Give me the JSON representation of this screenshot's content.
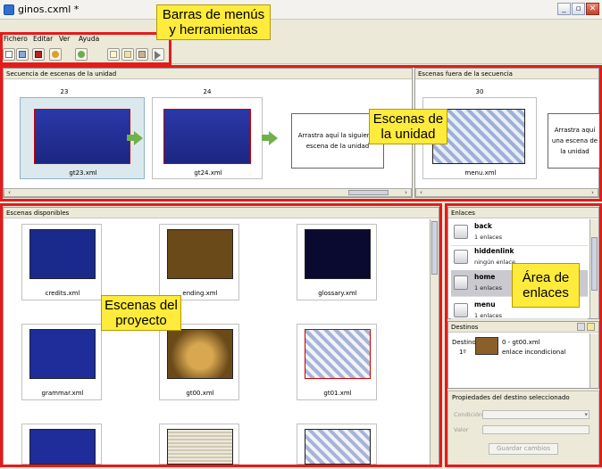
{
  "window": {
    "title": "ginos.cxml *"
  },
  "menubar": {
    "items": [
      "Fichero",
      "Editar",
      "Ver",
      "Ayuda"
    ]
  },
  "sequence_panel": {
    "title": "Secuencia de escenas de la unidad",
    "scenes": [
      {
        "num": "23",
        "file": "gt23.xml"
      },
      {
        "num": "24",
        "file": "gt24.xml"
      }
    ],
    "drop_text": "Arrastra aquí la siguiente escena de la unidad"
  },
  "outside_panel": {
    "title": "Escenas fuera de la secuencia",
    "scenes": [
      {
        "num": "30",
        "file": "menu.xml"
      }
    ],
    "drop_text": "Arrastra aquí una escena de la unidad"
  },
  "available_panel": {
    "title": "Escenas disponibles",
    "scenes": [
      "credits.xml",
      "ending.xml",
      "glossary.xml",
      "grammar.xml",
      "gt00.xml",
      "gt01.xml"
    ]
  },
  "links_panel": {
    "title": "Enlaces",
    "items": [
      {
        "name": "back",
        "count": "1 enlaces"
      },
      {
        "name": "hiddenlink",
        "count": "ningún enlace"
      },
      {
        "name": "home",
        "count": "1 enlaces"
      },
      {
        "name": "menu",
        "count": "1 enlaces"
      }
    ]
  },
  "destinations": {
    "title": "Destinos",
    "label": "Destino",
    "index": "1º",
    "target": "0 - gt00.xml",
    "kind": "enlace incondicional"
  },
  "properties": {
    "title": "Propiedades del destino seleccionado",
    "condition_label": "Condición",
    "value_label": "Valor",
    "save_button": "Guardar cambios"
  },
  "annotations": {
    "menus": "Barras de menús\ny herramientas",
    "unit": "Escenas de\nla unidad",
    "project": "Escenas del\nproyecto",
    "links": "Área de\nenlaces"
  },
  "colors": {
    "annotation_bg": "#ffeb3b",
    "annotation_border": "#e41b1b",
    "selected_bg": "#dbe9ef",
    "selected_link": "#c9c9cf"
  }
}
